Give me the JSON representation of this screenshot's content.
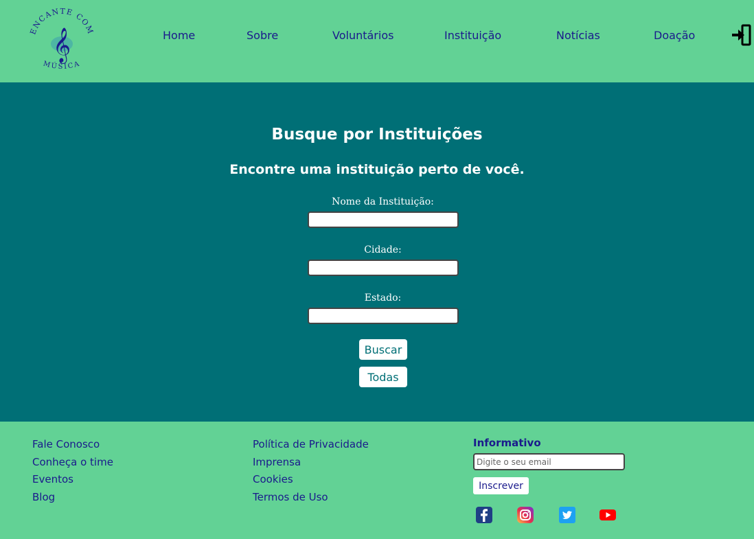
{
  "brand": {
    "logo_top": "ENCANTE COM",
    "logo_bottom": "MÚSICA"
  },
  "nav": {
    "items": [
      {
        "label": "Home"
      },
      {
        "label": "Sobre"
      },
      {
        "label": "Voluntários"
      },
      {
        "label": "Instituição"
      },
      {
        "label": "Notícias"
      },
      {
        "label": "Doação"
      }
    ],
    "login_icon": "sign-in-icon"
  },
  "search": {
    "title": "Busque por Instituições",
    "subtitle": "Encontre uma instituição perto de você.",
    "fields": [
      {
        "label": "Nome da Instituição:",
        "value": ""
      },
      {
        "label": "Cidade:",
        "value": ""
      },
      {
        "label": "Estado:",
        "value": ""
      }
    ],
    "search_button": "Buscar",
    "all_button": "Todas"
  },
  "footer": {
    "col1": [
      "Fale Conosco",
      "Conheça o time",
      "Eventos",
      "Blog"
    ],
    "col2": [
      "Política de Privacidade",
      "Imprensa",
      "Cookies",
      "Termos de Uso"
    ],
    "newsletter": {
      "title": "Informativo",
      "placeholder": "Digite o seu email",
      "button": "Inscrever"
    },
    "social": [
      "facebook-icon",
      "instagram-icon",
      "twitter-icon",
      "youtube-icon"
    ]
  },
  "colors": {
    "header_bg": "#62d295",
    "main_bg": "#006f76",
    "link": "#1a1a8c",
    "button_text": "#006f76"
  }
}
